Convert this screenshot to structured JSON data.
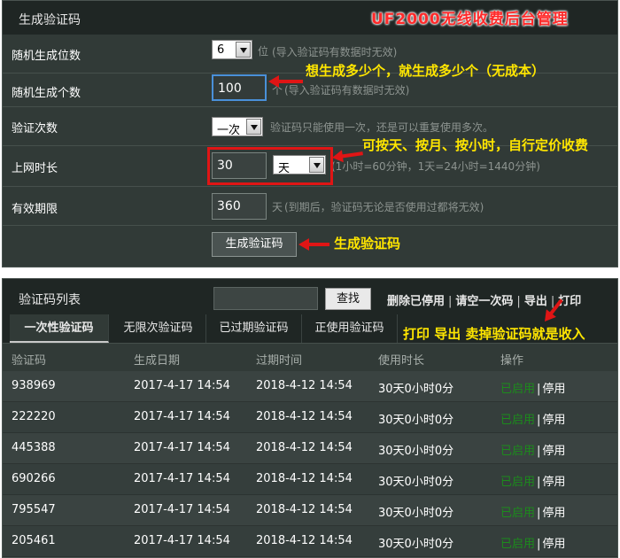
{
  "generator": {
    "title": "生成验证码",
    "promo": "UF2000无线收费后台管理",
    "rows": [
      {
        "label": "随机生成位数",
        "value": "6",
        "unit": "位",
        "hint": "(导入验证码有数据时无效)"
      },
      {
        "label": "随机生成个数",
        "value": "100",
        "unit": "个",
        "hint": "(导入验证码有数据时无效)"
      },
      {
        "label": "验证次数",
        "value": "一次",
        "hint": "验证码只能使用一次，还是可以重复使用多次。"
      },
      {
        "label": "上网时长",
        "value": "30",
        "unit_select": "天",
        "hint": "(1小时=60分钟，1天=24小时=1440分钟)"
      },
      {
        "label": "有效期限",
        "value": "360",
        "unit": "天",
        "hint": "(到期后，验证码无论是否使用过都将无效)"
      }
    ],
    "generate_button": "生成验证码",
    "annotations": {
      "count": "想生成多少个，就生成多少个（无成本）",
      "duration": "可按天、按月、按小时，自行定价收费",
      "generate": "生成验证码"
    }
  },
  "list": {
    "title": "验证码列表",
    "search_button": "查找",
    "actions": [
      "删除已停用",
      "请空一次码",
      "导出",
      "打印"
    ],
    "tabs": [
      "一次性验证码",
      "无限次验证码",
      "已过期验证码",
      "正使用验证码"
    ],
    "annotation": "打印 导出 卖掉验证码就是收入",
    "columns": [
      "验证码",
      "生成日期",
      "过期时间",
      "使用时长",
      "操作"
    ],
    "rows": [
      {
        "code": "938969",
        "created": "2017-4-17 14:54",
        "expires": "2018-4-12 14:54",
        "duration": "30天0小时0分",
        "status": "已启用",
        "action": "停用"
      },
      {
        "code": "222220",
        "created": "2017-4-17 14:54",
        "expires": "2018-4-12 14:54",
        "duration": "30天0小时0分",
        "status": "已启用",
        "action": "停用"
      },
      {
        "code": "445388",
        "created": "2017-4-17 14:54",
        "expires": "2018-4-12 14:54",
        "duration": "30天0小时0分",
        "status": "已启用",
        "action": "停用"
      },
      {
        "code": "690266",
        "created": "2017-4-17 14:54",
        "expires": "2018-4-12 14:54",
        "duration": "30天0小时0分",
        "status": "已启用",
        "action": "停用"
      },
      {
        "code": "795547",
        "created": "2017-4-17 14:54",
        "expires": "2018-4-12 14:54",
        "duration": "30天0小时0分",
        "status": "已启用",
        "action": "停用"
      },
      {
        "code": "205461",
        "created": "2017-4-17 14:54",
        "expires": "2018-4-12 14:54",
        "duration": "30天0小时0分",
        "status": "已启用",
        "action": "停用"
      }
    ]
  },
  "colors": {
    "panel_bg": "#313a37",
    "header_bg": "#1f2624",
    "annotation": "#ffe600",
    "highlight": "#e01515",
    "status_green": "#1c8c1c"
  }
}
